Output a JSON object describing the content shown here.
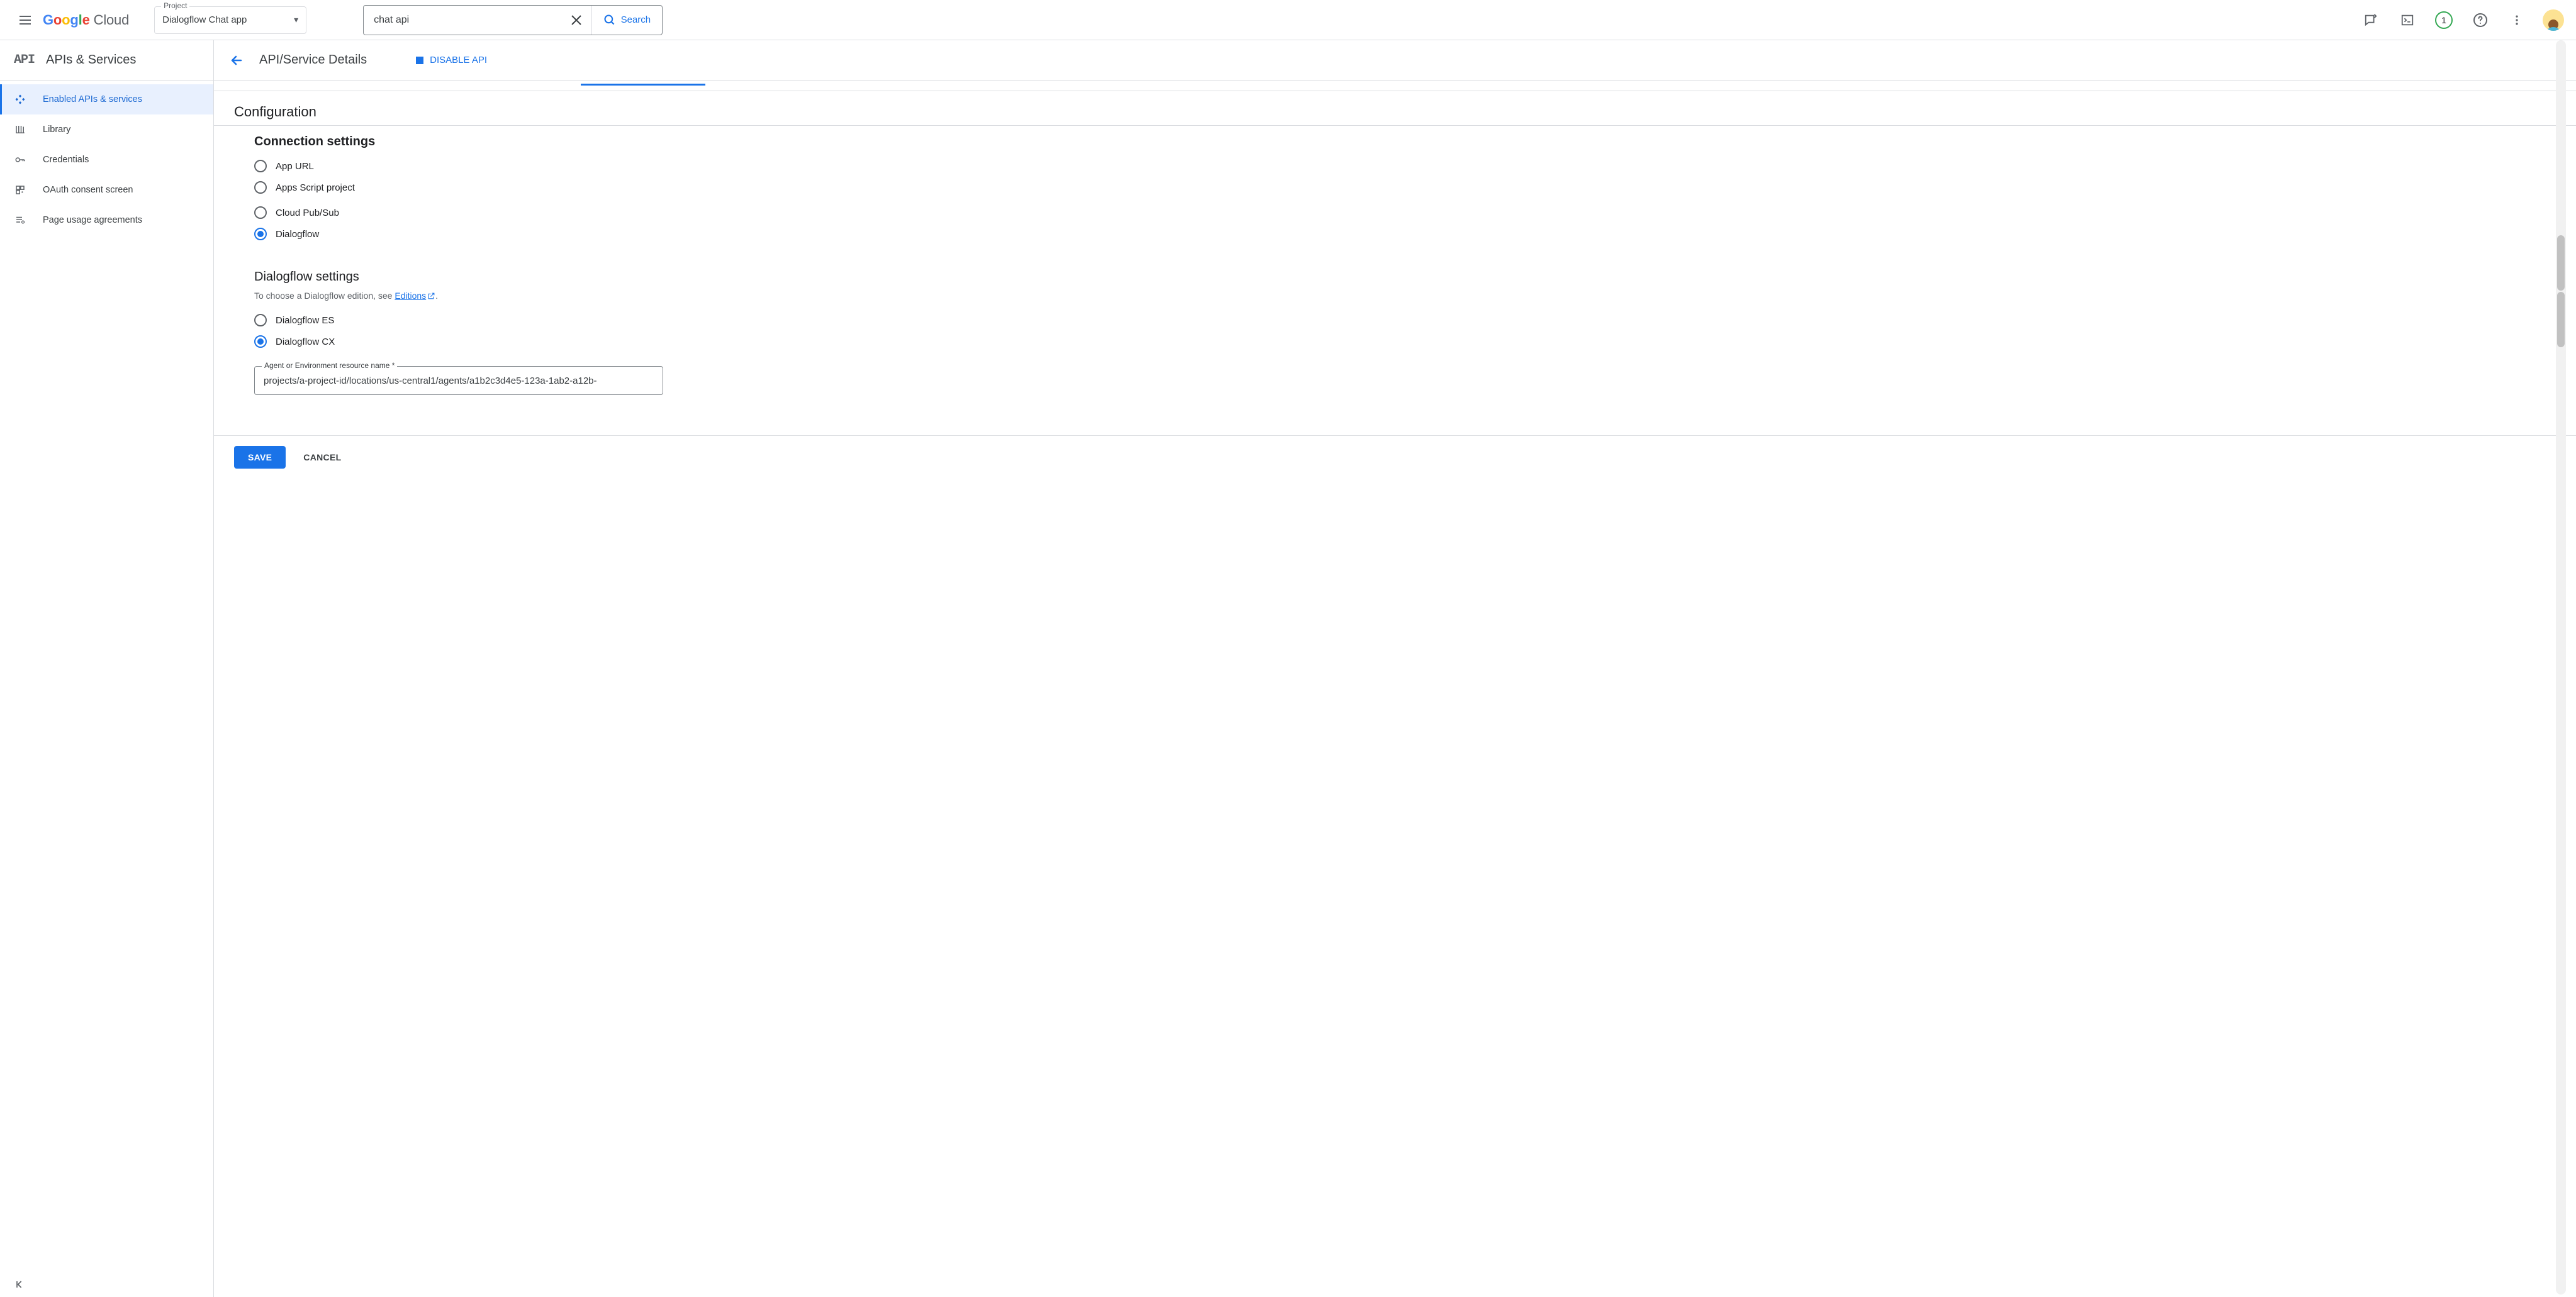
{
  "header": {
    "logo_text": "Google",
    "logo_suffix": "Cloud",
    "project_label": "Project",
    "project_value": "Dialogflow Chat app",
    "search_value": "chat api",
    "search_button": "Search",
    "badge_count": "1"
  },
  "sidebar": {
    "title": "APIs & Services",
    "items": [
      {
        "label": "Enabled APIs & services"
      },
      {
        "label": "Library"
      },
      {
        "label": "Credentials"
      },
      {
        "label": "OAuth consent screen"
      },
      {
        "label": "Page usage agreements"
      }
    ]
  },
  "main": {
    "title": "API/Service Details",
    "disable_label": "DISABLE API",
    "configuration_title": "Configuration",
    "connection_title": "Connection settings",
    "connection_options": [
      "App URL",
      "Apps Script project",
      "Cloud Pub/Sub",
      "Dialogflow"
    ],
    "dialogflow_title": "Dialogflow settings",
    "dialogflow_helper_pre": "To choose a Dialogflow edition, see ",
    "dialogflow_helper_link": "Editions",
    "dialogflow_helper_post": ".",
    "dialogflow_options": [
      "Dialogflow ES",
      "Dialogflow CX"
    ],
    "resource_label": "Agent or Environment resource name *",
    "resource_value": "projects/a-project-id/locations/us-central1/agents/a1b2c3d4e5-123a-1ab2-a12b-",
    "save_label": "SAVE",
    "cancel_label": "CANCEL"
  }
}
